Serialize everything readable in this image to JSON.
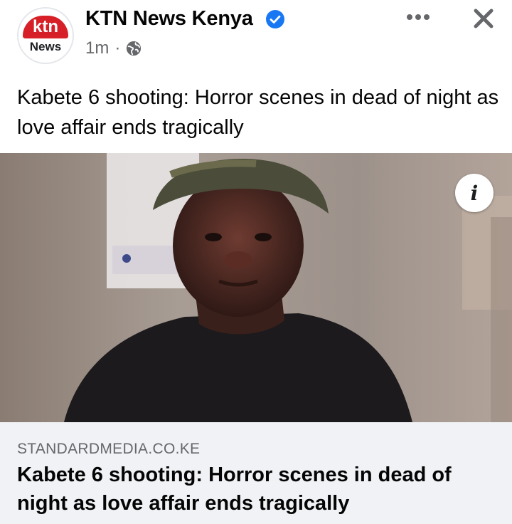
{
  "header": {
    "avatar_top": "ktn",
    "avatar_bottom": "News",
    "page_name": "KTN News Kenya",
    "time": "1m",
    "separator": "·",
    "privacy_icon": "globe-icon",
    "verified_icon": "verified-badge-icon",
    "more_icon": "more-options-icon",
    "close_icon": "close-icon"
  },
  "post": {
    "text": "Kabete 6 shooting: Horror scenes in dead of night as love affair ends tragically"
  },
  "image": {
    "info_label": "i",
    "info_icon": "info-icon"
  },
  "link_preview": {
    "domain": "STANDARDMEDIA.CO.KE",
    "title": "Kabete 6 shooting: Horror scenes in dead of night as love affair ends tragically"
  },
  "colors": {
    "brand_red": "#d61f26",
    "verified_blue": "#1877f2",
    "secondary_text": "#65676b",
    "link_box_bg": "#f0f2f5"
  }
}
